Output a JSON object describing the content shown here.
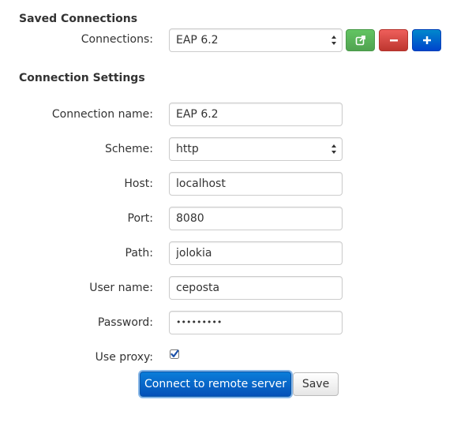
{
  "saved": {
    "title": "Saved Connections",
    "connections_label": "Connections:",
    "connections_value": "EAP 6.2",
    "icons": {
      "connect": "external-link-icon",
      "delete": "minus-icon",
      "add": "plus-icon"
    }
  },
  "settings": {
    "title": "Connection Settings",
    "name_label": "Connection name:",
    "name_value": "EAP 6.2",
    "scheme_label": "Scheme:",
    "scheme_value": "http",
    "host_label": "Host:",
    "host_value": "localhost",
    "port_label": "Port:",
    "port_value": "8080",
    "path_label": "Path:",
    "path_value": "jolokia",
    "user_label": "User name:",
    "user_value": "ceposta",
    "password_label": "Password:",
    "password_value": "•••••••••",
    "proxy_label": "Use proxy:",
    "proxy_checked": true
  },
  "actions": {
    "connect_label": "Connect to remote server",
    "save_label": "Save"
  },
  "colors": {
    "green": "#51a351",
    "red": "#bd362f",
    "blue": "#0044cc",
    "primary": "#0551b8",
    "text": "#333333"
  }
}
